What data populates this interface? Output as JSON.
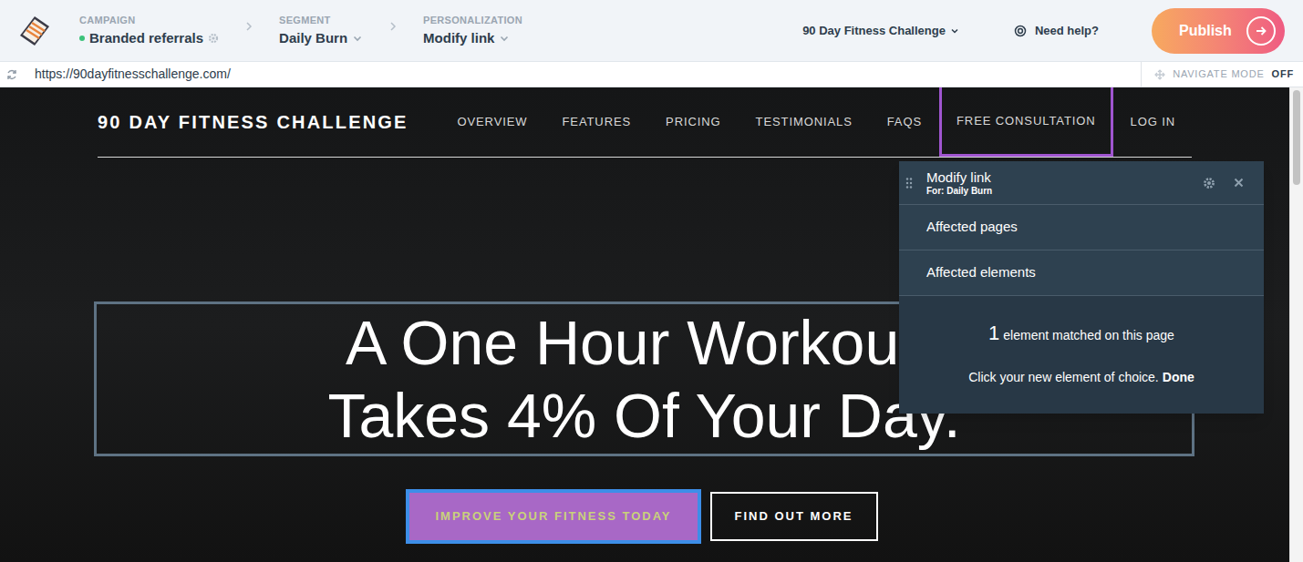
{
  "topbar": {
    "breadcrumbs": [
      {
        "label": "CAMPAIGN",
        "value": "Branded referrals",
        "kind": "status",
        "active": true
      },
      {
        "label": "SEGMENT",
        "value": "Daily Burn",
        "kind": "dropdown",
        "active": false
      },
      {
        "label": "PERSONALIZATION",
        "value": "Modify link",
        "kind": "dropdown",
        "active": false
      }
    ],
    "site_selector": "90 Day Fitness Challenge",
    "help": "Need help?",
    "publish": "Publish"
  },
  "address_bar": {
    "url": "https://90dayfitnesschallenge.com/",
    "navigate_mode_label": "NAVIGATE MODE",
    "navigate_mode": "OFF"
  },
  "site": {
    "brand": "90 DAY FITNESS CHALLENGE",
    "nav": [
      {
        "label": "OVERVIEW",
        "selected": false
      },
      {
        "label": "FEATURES",
        "selected": false
      },
      {
        "label": "PRICING",
        "selected": false
      },
      {
        "label": "TESTIMONIALS",
        "selected": false
      },
      {
        "label": "FAQS",
        "selected": false
      },
      {
        "label": "FREE CONSULTATION",
        "selected": true
      },
      {
        "label": "LOG IN",
        "selected": false
      }
    ],
    "headline": [
      "A One Hour Workou",
      "Takes 4% Of Your Day."
    ],
    "buttons": [
      {
        "label": "IMPROVE YOUR FITNESS TODAY",
        "selected": true
      },
      {
        "label": "FIND OUT MORE",
        "selected": false
      }
    ]
  },
  "panel": {
    "title": "Modify link",
    "subtitle": "For: Daily Burn",
    "rows": [
      "Affected pages",
      "Affected elements"
    ],
    "count": "1",
    "count_text": "element matched on this page",
    "instruction": "Click your new element of choice.",
    "done": "Done"
  }
}
